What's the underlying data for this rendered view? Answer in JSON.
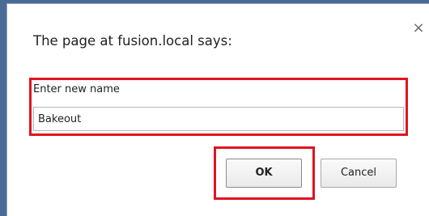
{
  "dialog": {
    "message": "The page at fusion.local says:",
    "close_icon": "close-icon",
    "close_glyph": "×",
    "prompt": {
      "label": "Enter new name",
      "value": "Bakeout"
    },
    "buttons": {
      "ok_label": "OK",
      "cancel_label": "Cancel"
    }
  },
  "colors": {
    "highlight": "#e0141e",
    "backdrop": "#4a6b98"
  }
}
